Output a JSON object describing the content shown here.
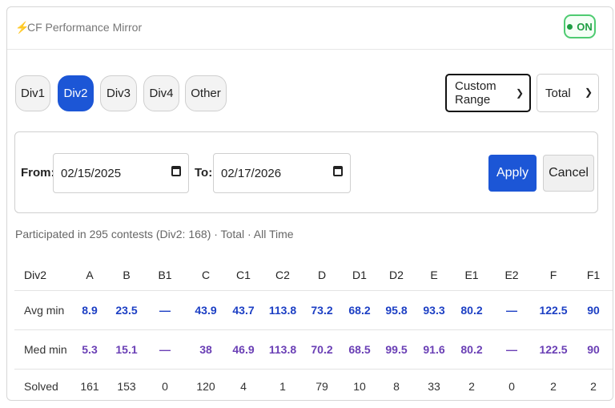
{
  "header": {
    "title": "CF Performance Mirror",
    "toggle_label": "ON"
  },
  "divisions": [
    "Div1",
    "Div2",
    "Div3",
    "Div4",
    "Other"
  ],
  "active_division": "Div2",
  "range_select": {
    "value": "Custom Range"
  },
  "metric_select": {
    "value": "Total"
  },
  "range": {
    "from_label": "From:",
    "from_value": "02/15/2025",
    "to_label": "To:",
    "to_value": "02/17/2026",
    "apply_label": "Apply",
    "cancel_label": "Cancel"
  },
  "summary": "Participated in 295 contests (Div2: 168) · Total · All Time",
  "table": {
    "columns": [
      "Div2",
      "A",
      "B",
      "B1",
      "C",
      "C1",
      "C2",
      "D",
      "D1",
      "D2",
      "E",
      "E1",
      "E2",
      "F",
      "F1"
    ],
    "rows": [
      {
        "label": "Avg min",
        "values": [
          "8.9",
          "23.5",
          "—",
          "43.9",
          "43.7",
          "113.8",
          "73.2",
          "68.2",
          "95.8",
          "93.3",
          "80.2",
          "—",
          "122.5",
          "90"
        ]
      },
      {
        "label": "Med min",
        "values": [
          "5.3",
          "15.1",
          "—",
          "38",
          "46.9",
          "113.8",
          "70.2",
          "68.5",
          "99.5",
          "91.6",
          "80.2",
          "—",
          "122.5",
          "90"
        ]
      },
      {
        "label": "Solved",
        "values": [
          "161",
          "153",
          "0",
          "120",
          "4",
          "1",
          "79",
          "10",
          "8",
          "33",
          "2",
          "0",
          "2",
          "2"
        ]
      }
    ]
  },
  "colors": {
    "accent": "#1c56d6",
    "toggle": "#1e9e43",
    "avg": "#1c3fc4",
    "median": "#6a3fb5"
  }
}
